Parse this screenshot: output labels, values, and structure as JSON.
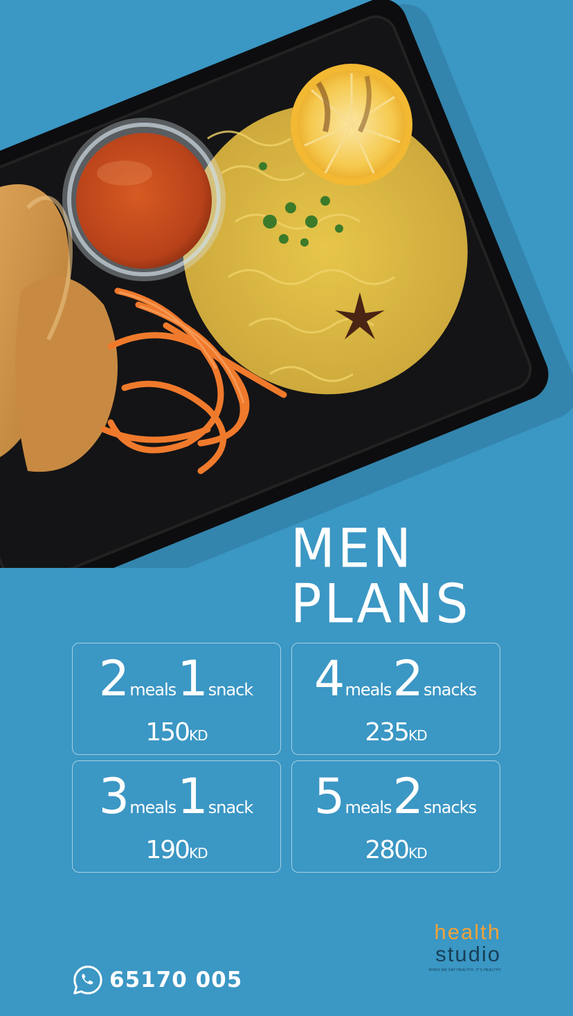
{
  "title": {
    "line1": "MEN",
    "line2": "PLANS"
  },
  "plans": [
    {
      "meals_count": "2",
      "meals_label": "meals",
      "snacks_count": "1",
      "snacks_label": "snack",
      "price": "150",
      "currency": "KD"
    },
    {
      "meals_count": "4",
      "meals_label": "meals",
      "snacks_count": "2",
      "snacks_label": "snacks",
      "price": "235",
      "currency": "KD"
    },
    {
      "meals_count": "3",
      "meals_label": "meals",
      "snacks_count": "1",
      "snacks_label": "snack",
      "price": "190",
      "currency": "KD"
    },
    {
      "meals_count": "5",
      "meals_label": "meals",
      "snacks_count": "2",
      "snacks_label": "snacks",
      "price": "280",
      "currency": "KD"
    }
  ],
  "contact": {
    "icon": "whatsapp-icon",
    "phone": "65170 005"
  },
  "brand": {
    "word1": "health",
    "word2": "studio",
    "tagline": "WHEN WE SAY HEALTHY, IT'S HEALTHY"
  },
  "colors": {
    "background": "#3b97c4",
    "brand_orange": "#f0a23a",
    "brand_navy": "#173f57",
    "text": "#ffffff"
  }
}
